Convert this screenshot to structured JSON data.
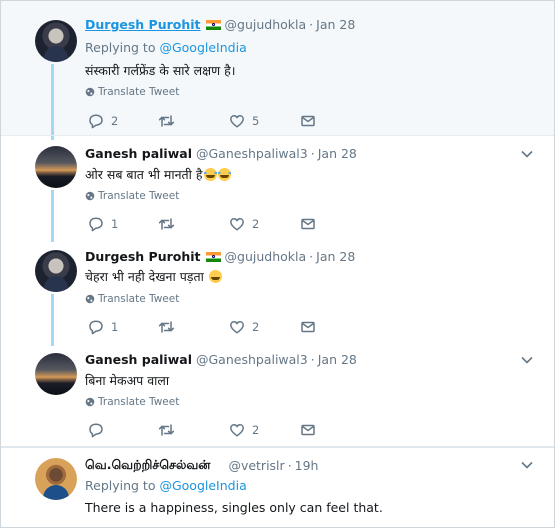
{
  "tweets": [
    {
      "name": "Durgesh Purohit",
      "flag": true,
      "handle": "@gujudhokla",
      "dot": "·",
      "time": "Jan 28",
      "replying_prefix": "Replying to",
      "replying_to": "@GoogleIndia",
      "text": "संस्कारी गर्लफ्रेंड के सारे लक्षण है।",
      "translate": "Translate Tweet",
      "reply_count": "2",
      "retweet_count": "",
      "like_count": "5"
    },
    {
      "name": "Ganesh paliwal",
      "flag": false,
      "handle": "@Ganeshpaliwal3",
      "dot": "·",
      "time": "Jan 28",
      "text": "ओर सब बात भी मानती है",
      "translate": "Translate Tweet",
      "reply_count": "1",
      "retweet_count": "",
      "like_count": "2"
    },
    {
      "name": "Durgesh Purohit",
      "flag": true,
      "handle": "@gujudhokla",
      "dot": "·",
      "time": "Jan 28",
      "text": "चेहरा भी नही देखना पड़ता",
      "translate": "Translate Tweet",
      "reply_count": "1",
      "retweet_count": "",
      "like_count": "2"
    },
    {
      "name": "Ganesh paliwal",
      "flag": false,
      "handle": "@Ganeshpaliwal3",
      "dot": "·",
      "time": "Jan 28",
      "text": "बिना मेकअप वाला",
      "translate": "Translate Tweet",
      "reply_count": "",
      "retweet_count": "",
      "like_count": "2"
    },
    {
      "name": "வெ.வெற்றிச்செல்வன்",
      "flag": false,
      "handle": "@vetrislr",
      "dot": "·",
      "time": "19h",
      "replying_prefix": "Replying to",
      "replying_to": "@GoogleIndia",
      "text": "There is a happiness, singles only can feel that."
    }
  ],
  "icons": {
    "reply": "reply-icon",
    "retweet": "retweet-icon",
    "like": "heart-icon",
    "message": "envelope-icon",
    "translate": "globe-icon",
    "more": "chevron-down-icon"
  },
  "colors": {
    "link": "#1b95e0",
    "muted": "#657786",
    "thread": "#a4d8f4",
    "highlight_bg": "#f5f8fa"
  }
}
